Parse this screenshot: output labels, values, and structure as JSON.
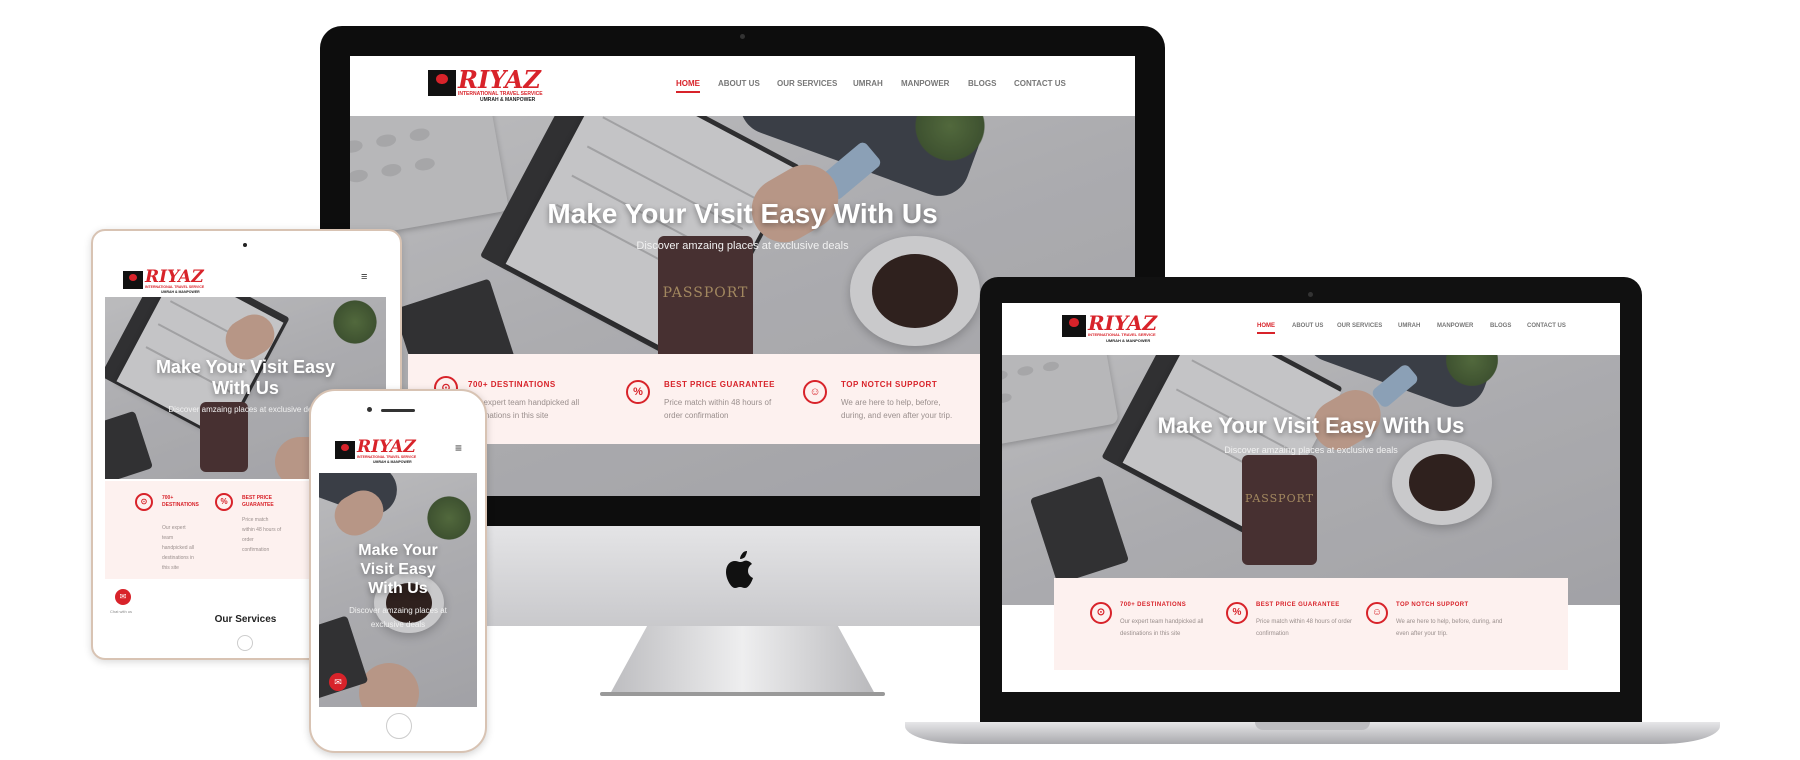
{
  "brand": {
    "name": "RIYAZ",
    "tagline": "INTERNATIONAL TRAVEL SERVICE",
    "subtagline": "UMRAH & MANPOWER"
  },
  "nav": {
    "items": [
      "HOME",
      "ABOUT US",
      "OUR SERVICES",
      "UMRAH",
      "MANPOWER",
      "BLOGS",
      "CONTACT US"
    ],
    "active": "HOME"
  },
  "hero": {
    "title": "Make Your Visit Easy With Us",
    "title_line1": "Make Your Visit Easy",
    "title_line2": "With Us",
    "phone_line1": "Make Your",
    "phone_line2": "Visit Easy",
    "phone_line3": "With Us",
    "subtitle": "Discover amzaing places at exclusive deals",
    "passport_label": "PASSPORT"
  },
  "features": [
    {
      "icon": "map-pin-icon",
      "title": "700+ DESTINATIONS",
      "desc": "Our expert team handpicked all destinations in this site"
    },
    {
      "icon": "percent-badge-icon",
      "title": "BEST PRICE GUARANTEE",
      "desc": "Price match within 48 hours of order confirmation"
    },
    {
      "icon": "support-people-icon",
      "title": "TOP NOTCH SUPPORT",
      "desc": "We are here to help, before, during, and even after your trip."
    }
  ],
  "tablet": {
    "feature_titles": [
      "700+ DESTINATIONS",
      "BEST PRICE GUARANTEE"
    ],
    "feature_descs": [
      "Our expert team handpicked all destinations in this site",
      "Price match within 48 hours of order confirmation"
    ],
    "section_heading": "Our Services",
    "chat_label": "Chat with us"
  },
  "colors": {
    "brand_red": "#d8232a",
    "feature_bg": "#fdf1ef",
    "device_black": "#111111"
  }
}
